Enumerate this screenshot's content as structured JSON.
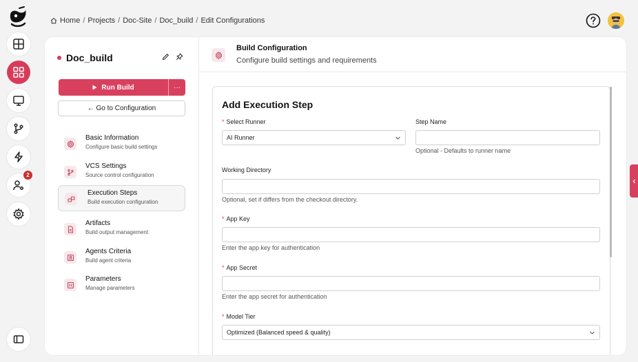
{
  "breadcrumb": {
    "items": [
      "Home",
      "Projects",
      "Doc-Site",
      "Doc_build",
      "Edit Configurations"
    ],
    "separator": "/"
  },
  "rail": {
    "notification_count": "2",
    "icons": [
      "logo-icon",
      "dashboard-icon",
      "apps-grid-icon",
      "monitor-icon",
      "branch-icon",
      "lightning-icon",
      "user-settings-icon",
      "gear-icon",
      "sidebar-toggle-icon"
    ]
  },
  "colors": {
    "accent": "#d8405e",
    "badge": "#c8312f"
  },
  "project": {
    "title": "Doc_build"
  },
  "actions": {
    "run_label": "Run Build",
    "more_label": "···",
    "goto_label": "← Go to Configuration"
  },
  "nav": [
    {
      "title": "Basic Information",
      "subtitle": "Configure basic build settings",
      "icon": "gear-icon"
    },
    {
      "title": "VCS Settings",
      "subtitle": "Source control configuration",
      "icon": "branch-icon"
    },
    {
      "title": "Execution Steps",
      "subtitle": "Build execution configuration",
      "icon": "steps-icon"
    },
    {
      "title": "Artifacts",
      "subtitle": "Build output management",
      "icon": "document-icon"
    },
    {
      "title": "Agents Criteria",
      "subtitle": "Build agent criteria",
      "icon": "agent-icon"
    },
    {
      "title": "Parameters",
      "subtitle": "Manage parameters",
      "icon": "parameters-icon"
    }
  ],
  "header": {
    "title": "Build Configuration",
    "subtitle": "Configure build settings and requirements"
  },
  "form": {
    "title": "Add Execution Step",
    "runner": {
      "label": "Select Runner",
      "required_mark": "*",
      "value": "AI Runner"
    },
    "step_name": {
      "label": "Step Name",
      "value": "",
      "hint": "Optional - Defaults to runner name"
    },
    "working_dir": {
      "label": "Working Directory",
      "value": "",
      "hint": "Optional, set if differs from the checkout directory."
    },
    "app_key": {
      "label": "App Key",
      "required_mark": "*",
      "value": "",
      "hint": "Enter the app key for authentication"
    },
    "app_secret": {
      "label": "App Secret",
      "required_mark": "*",
      "value": "",
      "hint": "Enter the app secret for authentication"
    },
    "model_tier": {
      "label": "Model Tier",
      "required_mark": "*",
      "value": "Optimized (Balanced speed & quality)"
    }
  }
}
